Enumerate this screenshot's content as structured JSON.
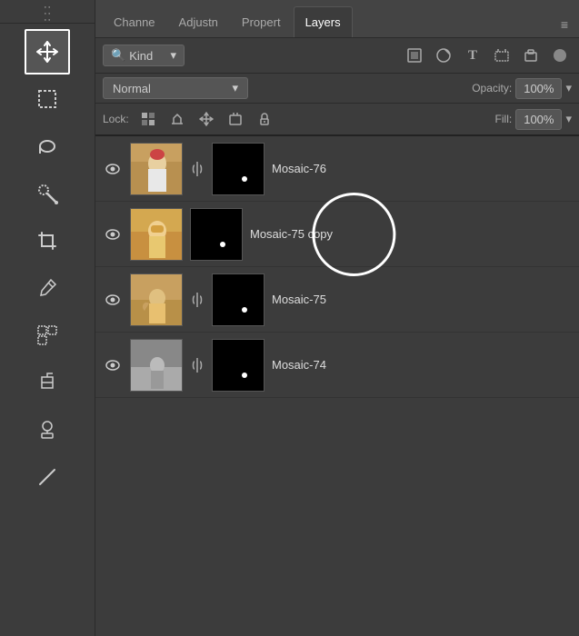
{
  "toolbar": {
    "tools": [
      {
        "name": "move-tool",
        "icon": "⊹",
        "active": true
      },
      {
        "name": "marquee-tool",
        "icon": "⬚",
        "active": false
      },
      {
        "name": "lasso-tool",
        "icon": "⌒",
        "active": false
      },
      {
        "name": "brush-tool",
        "icon": "✏",
        "active": false
      },
      {
        "name": "crop-tool",
        "icon": "⊡",
        "active": false
      },
      {
        "name": "eyedropper-tool",
        "icon": "💧",
        "active": false
      },
      {
        "name": "selection-tool",
        "icon": "⊞",
        "active": false
      },
      {
        "name": "paint-tool",
        "icon": "✒",
        "active": false
      },
      {
        "name": "stamp-tool",
        "icon": "🖬",
        "active": false
      },
      {
        "name": "line-tool",
        "icon": "╱",
        "active": false
      }
    ]
  },
  "tabs": {
    "items": [
      {
        "id": "channels",
        "label": "Channe"
      },
      {
        "id": "adjustments",
        "label": "Adjustn"
      },
      {
        "id": "properties",
        "label": "Propert"
      },
      {
        "id": "layers",
        "label": "Layers",
        "active": true
      }
    ],
    "menu_icon": "≡"
  },
  "filter_row": {
    "dropdown_label": "Kind",
    "search_icon": "🔍",
    "icons": [
      "image-icon",
      "circle-icon",
      "text-icon",
      "transform-icon",
      "lock-icon"
    ],
    "toggle_icon": "⬤"
  },
  "blend_row": {
    "blend_mode": "Normal",
    "blend_dropdown_arrow": "▾",
    "opacity_label": "Opacity:",
    "opacity_value": "100%",
    "opacity_arrow": "▾"
  },
  "lock_row": {
    "lock_label": "Lock:",
    "icons": [
      "checkerboard",
      "brush",
      "move",
      "artboard",
      "padlock"
    ],
    "fill_label": "Fill:",
    "fill_value": "100%",
    "fill_arrow": "▾"
  },
  "layers": [
    {
      "id": "mosaic-76",
      "name": "Mosaic-76",
      "visible": true,
      "has_link": true,
      "thumb_class": "thumb-mosaic76",
      "circle_overlay": false
    },
    {
      "id": "mosaic-75-copy",
      "name": "Mosaic-75 copy",
      "visible": true,
      "has_link": false,
      "thumb_class": "thumb-mosaic75copy",
      "circle_overlay": true
    },
    {
      "id": "mosaic-75",
      "name": "Mosaic-75",
      "visible": true,
      "has_link": true,
      "thumb_class": "thumb-mosaic75",
      "circle_overlay": false
    },
    {
      "id": "mosaic-74",
      "name": "Mosaic-74",
      "visible": true,
      "has_link": true,
      "thumb_class": "thumb-mosaic74",
      "circle_overlay": false
    }
  ]
}
